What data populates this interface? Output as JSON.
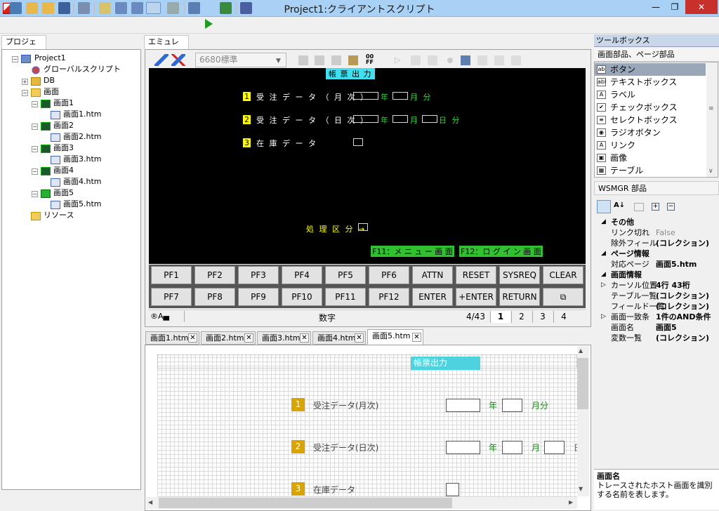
{
  "window": {
    "title": "Project1:クライアントスクリプト",
    "min": "—",
    "restore": "❐",
    "close": "✕"
  },
  "project": {
    "tab": "プロジェクト",
    "tree": [
      "Project1",
      "グローバルスクリプト",
      "DB",
      "画面",
      "画面1",
      "画面1.htm",
      "画面2",
      "画面2.htm",
      "画面3",
      "画面3.htm",
      "画面4",
      "画面4.htm",
      "画面5",
      "画面5.htm",
      "リソース"
    ]
  },
  "emulator": {
    "tab": "エミュレータ",
    "select": "6680標準",
    "screen": {
      "title": "帳 票 出 力",
      "n1": "1",
      "row1": "受 注 デ ー タ （ 月 次 ）",
      "n2": "2",
      "row2": "受 注 デ ー タ （ 日 次 ）",
      "n3": "3",
      "row3": "在 庫 デ ー タ",
      "year": "年",
      "month": "月",
      "month2": "月 分",
      "day": "日 分",
      "proc": "処 理 区 分 →",
      "f11": "F11：メ ニ ュ ー 画 面",
      "f12": "F12：ロ グ イ ン 画 面"
    },
    "keys": [
      "PF1",
      "PF2",
      "PF3",
      "PF4",
      "PF5",
      "PF6",
      "ATTN",
      "RESET",
      "SYSREQ",
      "CLEAR",
      "PF7",
      "PF8",
      "PF9",
      "PF10",
      "PF11",
      "PF12",
      "ENTER",
      "+ENTER",
      "RETURN",
      "⧉"
    ],
    "status": {
      "mode": "®A▄",
      "input": "数字",
      "cursor": "4/43",
      "pages": [
        "1",
        "2",
        "3",
        "4"
      ]
    }
  },
  "doc_tabs": [
    "画面1.htm",
    "画面2.htm",
    "画面3.htm",
    "画面4.htm",
    "画面5.htm"
  ],
  "designer": {
    "title": "帳票出力",
    "n1": "1",
    "row1": "受注データ(月次)",
    "n2": "2",
    "row2": "受注データ(日次)",
    "n3": "3",
    "row3": "在庫データ",
    "year": "年",
    "month": "月",
    "month_bun": "月分",
    "day": "日"
  },
  "toolbox": {
    "title": "ツールボックス",
    "section": "画面部品、ページ部品",
    "items": [
      {
        "icon": "ab",
        "label": "ボタン"
      },
      {
        "icon": "abl",
        "label": "テキストボックス"
      },
      {
        "icon": "A",
        "label": "ラベル"
      },
      {
        "icon": "✔",
        "label": "チェックボックス"
      },
      {
        "icon": "≡",
        "label": "セレクトボックス"
      },
      {
        "icon": "◉",
        "label": "ラジオボタン"
      },
      {
        "icon": "A",
        "label": "リンク"
      },
      {
        "icon": "▣",
        "label": "画像"
      },
      {
        "icon": "▦",
        "label": "テーブル"
      }
    ]
  },
  "properties": {
    "title": "WSMGR 部品",
    "rows": [
      {
        "type": "cat",
        "key": "その他",
        "value": ""
      },
      {
        "type": "prop",
        "key": "リンク切れ",
        "value": "False"
      },
      {
        "type": "prop",
        "key": "除外フィール",
        "value": "(コレクション)"
      },
      {
        "type": "cat",
        "key": "ページ情報",
        "value": ""
      },
      {
        "type": "prop",
        "key": "対応ページ",
        "value": "画面5.htm"
      },
      {
        "type": "cat",
        "key": "画面情報",
        "value": ""
      },
      {
        "type": "prop",
        "key": "カーソル位置",
        "value": "4行 43桁"
      },
      {
        "type": "prop",
        "key": "テーブル一覧",
        "value": "(コレクション)"
      },
      {
        "type": "prop",
        "key": "フィールド一覧",
        "value": "(コレクション)"
      },
      {
        "type": "prop",
        "key": "画面一致条",
        "value": "1件のAND条件"
      },
      {
        "type": "prop",
        "key": "画面名",
        "value": "画面5"
      },
      {
        "type": "prop",
        "key": "変数一覧",
        "value": "(コレクション)"
      }
    ],
    "desc_title": "画面名",
    "desc_text": "トレースされたホスト画面を識別する名前を表します。"
  }
}
